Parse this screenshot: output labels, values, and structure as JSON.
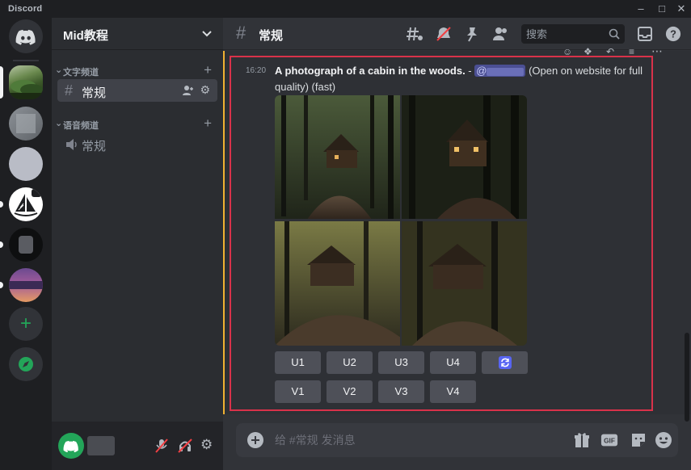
{
  "window": {
    "brand": "Discord",
    "controls": [
      "minimize",
      "maximize",
      "close"
    ]
  },
  "server_rail": {
    "servers": [
      "home",
      "server-forest",
      "server-gray",
      "server-light",
      "server-midjourney",
      "server-dark",
      "server-sunset"
    ],
    "add_server": "+",
    "explore": "compass"
  },
  "sidebar": {
    "guild_name": "Mid教程",
    "categories": [
      {
        "label": "文字频道",
        "channels": [
          {
            "name": "常规",
            "type": "text",
            "active": true
          }
        ]
      },
      {
        "label": "语音频道",
        "channels": [
          {
            "name": "常规",
            "type": "voice",
            "active": false
          }
        ]
      }
    ]
  },
  "header": {
    "channel_name": "常规",
    "search_placeholder": "搜索"
  },
  "message": {
    "timestamp": "16:20",
    "prompt": "A photograph of a cabin in the woods.",
    "separator": " - ",
    "mention": "@",
    "suffix": " (Open on website for full quality) (fast)",
    "upscale_buttons": [
      "U1",
      "U2",
      "U3",
      "U4"
    ],
    "variation_buttons": [
      "V1",
      "V2",
      "V3",
      "V4"
    ],
    "reroll_icon": "refresh-icon"
  },
  "composer": {
    "placeholder": "给 #常规 发消息"
  },
  "colors": {
    "accent_bar": "#f0b132",
    "highlight_border": "#d9324a",
    "button": "#4e5058",
    "reroll_button": "#4e5058",
    "reroll_icon_color": "#5865f2",
    "discord_blue": "#5865f2",
    "green": "#23a559"
  }
}
